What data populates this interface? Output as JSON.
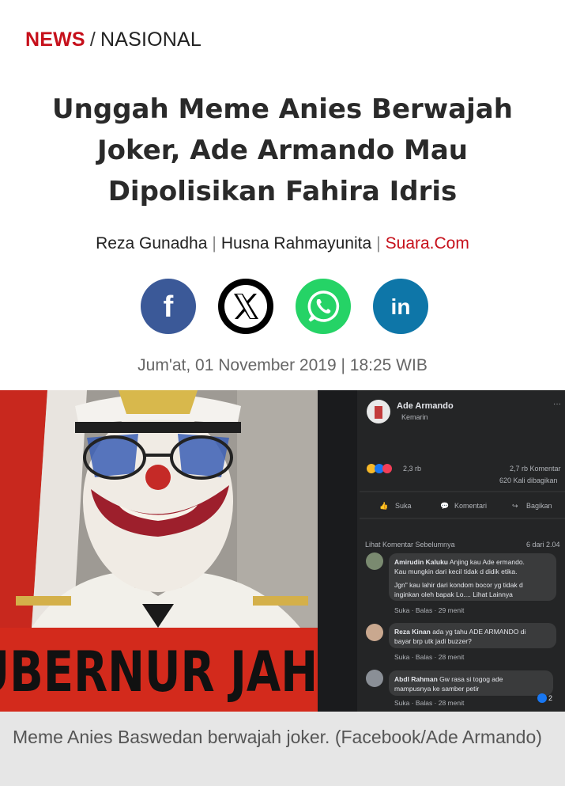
{
  "breadcrumb": {
    "category": "NEWS",
    "separator": "/",
    "section": "NASIONAL"
  },
  "article": {
    "title": "Unggah Meme Anies Berwajah Joker, Ade Armando Mau Dipolisikan Fahira Idris",
    "author1": "Reza Gunadha",
    "author2": "Husna Rahmayunita",
    "source": "Suara.Com",
    "date": "Jum'at, 01 November 2019 | 18:25 WIB"
  },
  "share": {
    "facebook_icon": "facebook-icon",
    "x_icon": "x-twitter-icon",
    "whatsapp_icon": "whatsapp-icon",
    "linkedin_icon": "linkedin-icon"
  },
  "image": {
    "banner_text": "GUBERNUR JAHAT",
    "fb_post": {
      "name": "Ade Armando",
      "time": "Kemarin",
      "reactions": "2,3 rb",
      "comments_count": "2,7 rb Komentar",
      "shares_count": "620 Kali dibagikan",
      "like": "Suka",
      "comment": "Komentari",
      "share": "Bagikan",
      "prev_comments": "Lihat Komentar Sebelumnya",
      "count_of": "6 dari 2.04",
      "comments": [
        {
          "name": "Amirudin Kaluku",
          "text1": "Anjing kau Ade ermando.",
          "text2": "Kau mungkin dari kecil tidak d didik etika.",
          "text3": "Jgn\" kau lahir dari kondom bocor yg tidak d",
          "text4": "inginkan oleh bapak Lo.... Lihat Lainnya",
          "meta": "Suka · Balas · 29 menit"
        },
        {
          "name": "Reza Kinan",
          "text1": "ada yg tahu ADE ARMANDO di",
          "text2": "bayar brp utk jadi buzzer?",
          "meta": "Suka · Balas · 28 menit"
        },
        {
          "name": "Abdl Rahman",
          "text1": "Gw rasa si togog ade",
          "text2": "mampusnya ke samber petir",
          "meta": "Suka · Balas · 28 menit",
          "badge": "2"
        }
      ]
    }
  },
  "caption": "Meme Anies Baswedan berwajah joker. (Facebook/Ade Armando)"
}
